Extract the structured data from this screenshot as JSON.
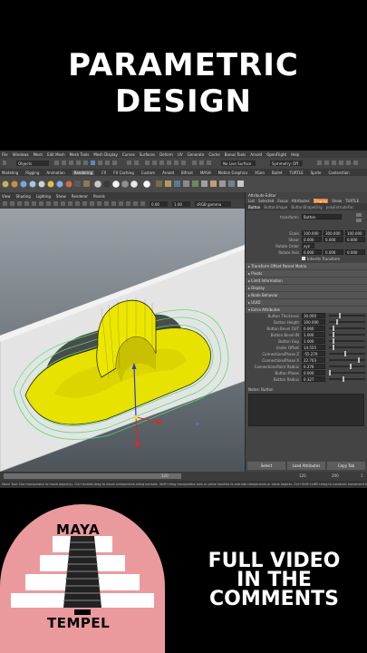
{
  "headline": {
    "line1": "PARAMETRIC",
    "line2": "DESIGN"
  },
  "maya": {
    "menubar": [
      "File",
      "Windows",
      "Mesh",
      "Edit Mesh",
      "Mesh Tools",
      "Mesh Display",
      "Curves",
      "Surfaces",
      "Deform",
      "UV",
      "Generate",
      "Cache",
      "Bonus Tools",
      "Arnold",
      "OpenFlight",
      "Help"
    ],
    "status": {
      "objects_label": "Objects",
      "live_surface": "No Live Surface",
      "symmetry": "Symmetry: Off"
    },
    "shelf_tabs": [
      "Modeling",
      "Rigging",
      "Animation",
      "Rendering",
      "FX",
      "FX Caching",
      "Custom",
      "Arnold",
      "Bifrost",
      "MASH",
      "Motion Graphics",
      "XGen",
      "Bullet",
      "TURTLE",
      "Sprite",
      "Coolsection"
    ],
    "shelf_active": "Rendering",
    "panel_menu": [
      "View",
      "Shading",
      "Lighting",
      "Show",
      "Renderer",
      "Panels"
    ],
    "panel_tools": {
      "val_a": "0.00",
      "val_b": "1.00",
      "colorspace": "sRGB gamma"
    },
    "attribute_editor": {
      "title": "Attribute Editor",
      "menu": [
        "List",
        "Selected",
        "Focus",
        "Attributes",
        "Display",
        "Show",
        "TURTLE"
      ],
      "menu_highlight": "Display",
      "tabs": [
        "Button",
        "ButtonShape",
        "ButtonShapeOrig",
        "polyExtrudeFac"
      ],
      "transform_label": "transform:",
      "transform_value": "Button",
      "transform_rows": [
        {
          "label": "Scale",
          "v": [
            "100.000",
            "300.000",
            "100.000"
          ]
        },
        {
          "label": "Shear",
          "v": [
            "0.000",
            "0.000",
            "0.000"
          ]
        },
        {
          "label": "Rotate Order",
          "v": [
            "xyz"
          ]
        },
        {
          "label": "Rotate Axis",
          "v": [
            "0.000",
            "0.000",
            "0.000"
          ]
        }
      ],
      "inherits": "Inherits Transform",
      "sections": [
        "Transform Offset Parent Matrix",
        "Pivots",
        "Limit Information",
        "Display",
        "Node Behavior",
        "UUID"
      ],
      "extra_section": "Extra Attributes",
      "extra_attrs": [
        {
          "label": "Button Thickness",
          "value": "30.000",
          "knob": 0.3
        },
        {
          "label": "Button Height",
          "value": "100.000",
          "knob": 0.2
        },
        {
          "label": "Button Bevel OUT",
          "value": "0.060",
          "knob": 0.1
        },
        {
          "label": "Button Bevel IN",
          "value": "1.000",
          "knob": 0.1
        },
        {
          "label": "Button Gap",
          "value": "1.000",
          "knob": 0.1
        },
        {
          "label": "Under Offset",
          "value": "14.555",
          "knob": 0.1
        },
        {
          "label": "ConnectionsPhase Z",
          "value": "-55.270",
          "knob": 0.45
        },
        {
          "label": "ConnectionsPhase X",
          "value": "22.703",
          "knob": 0.85
        },
        {
          "label": "ConnectionsPoint Radius",
          "value": "0.276",
          "knob": 0.6
        },
        {
          "label": "Button Phase",
          "value": "0.000",
          "knob": 0.0
        },
        {
          "label": "Button Radius",
          "value": "0.327",
          "knob": 0.4
        }
      ],
      "notes_label": "Notes: Button",
      "buttons": [
        "Select",
        "Load Attributes",
        "Copy Tab"
      ]
    },
    "timeline": {
      "a": "120",
      "b": "120",
      "c": "200",
      "d": "1"
    },
    "help_line": "Move Tool: Use manipulator to move object(s). Ctrl+middle-drag to move components along normals. Shift+drag manipulator axis or plane handles to extrude components or clone objects. Ctrl+Shift+LMB+drag to constrain movement to a connected edge. Use D or INSERT to change the pivot position and axis orientation."
  },
  "brand": {
    "top": "MAYA",
    "bottom": "TEMPEL",
    "accent": "#ea9a9d"
  },
  "cta": {
    "line1": "FULL VIDEO",
    "line2": "IN THE",
    "line3": "COMMENTS"
  }
}
